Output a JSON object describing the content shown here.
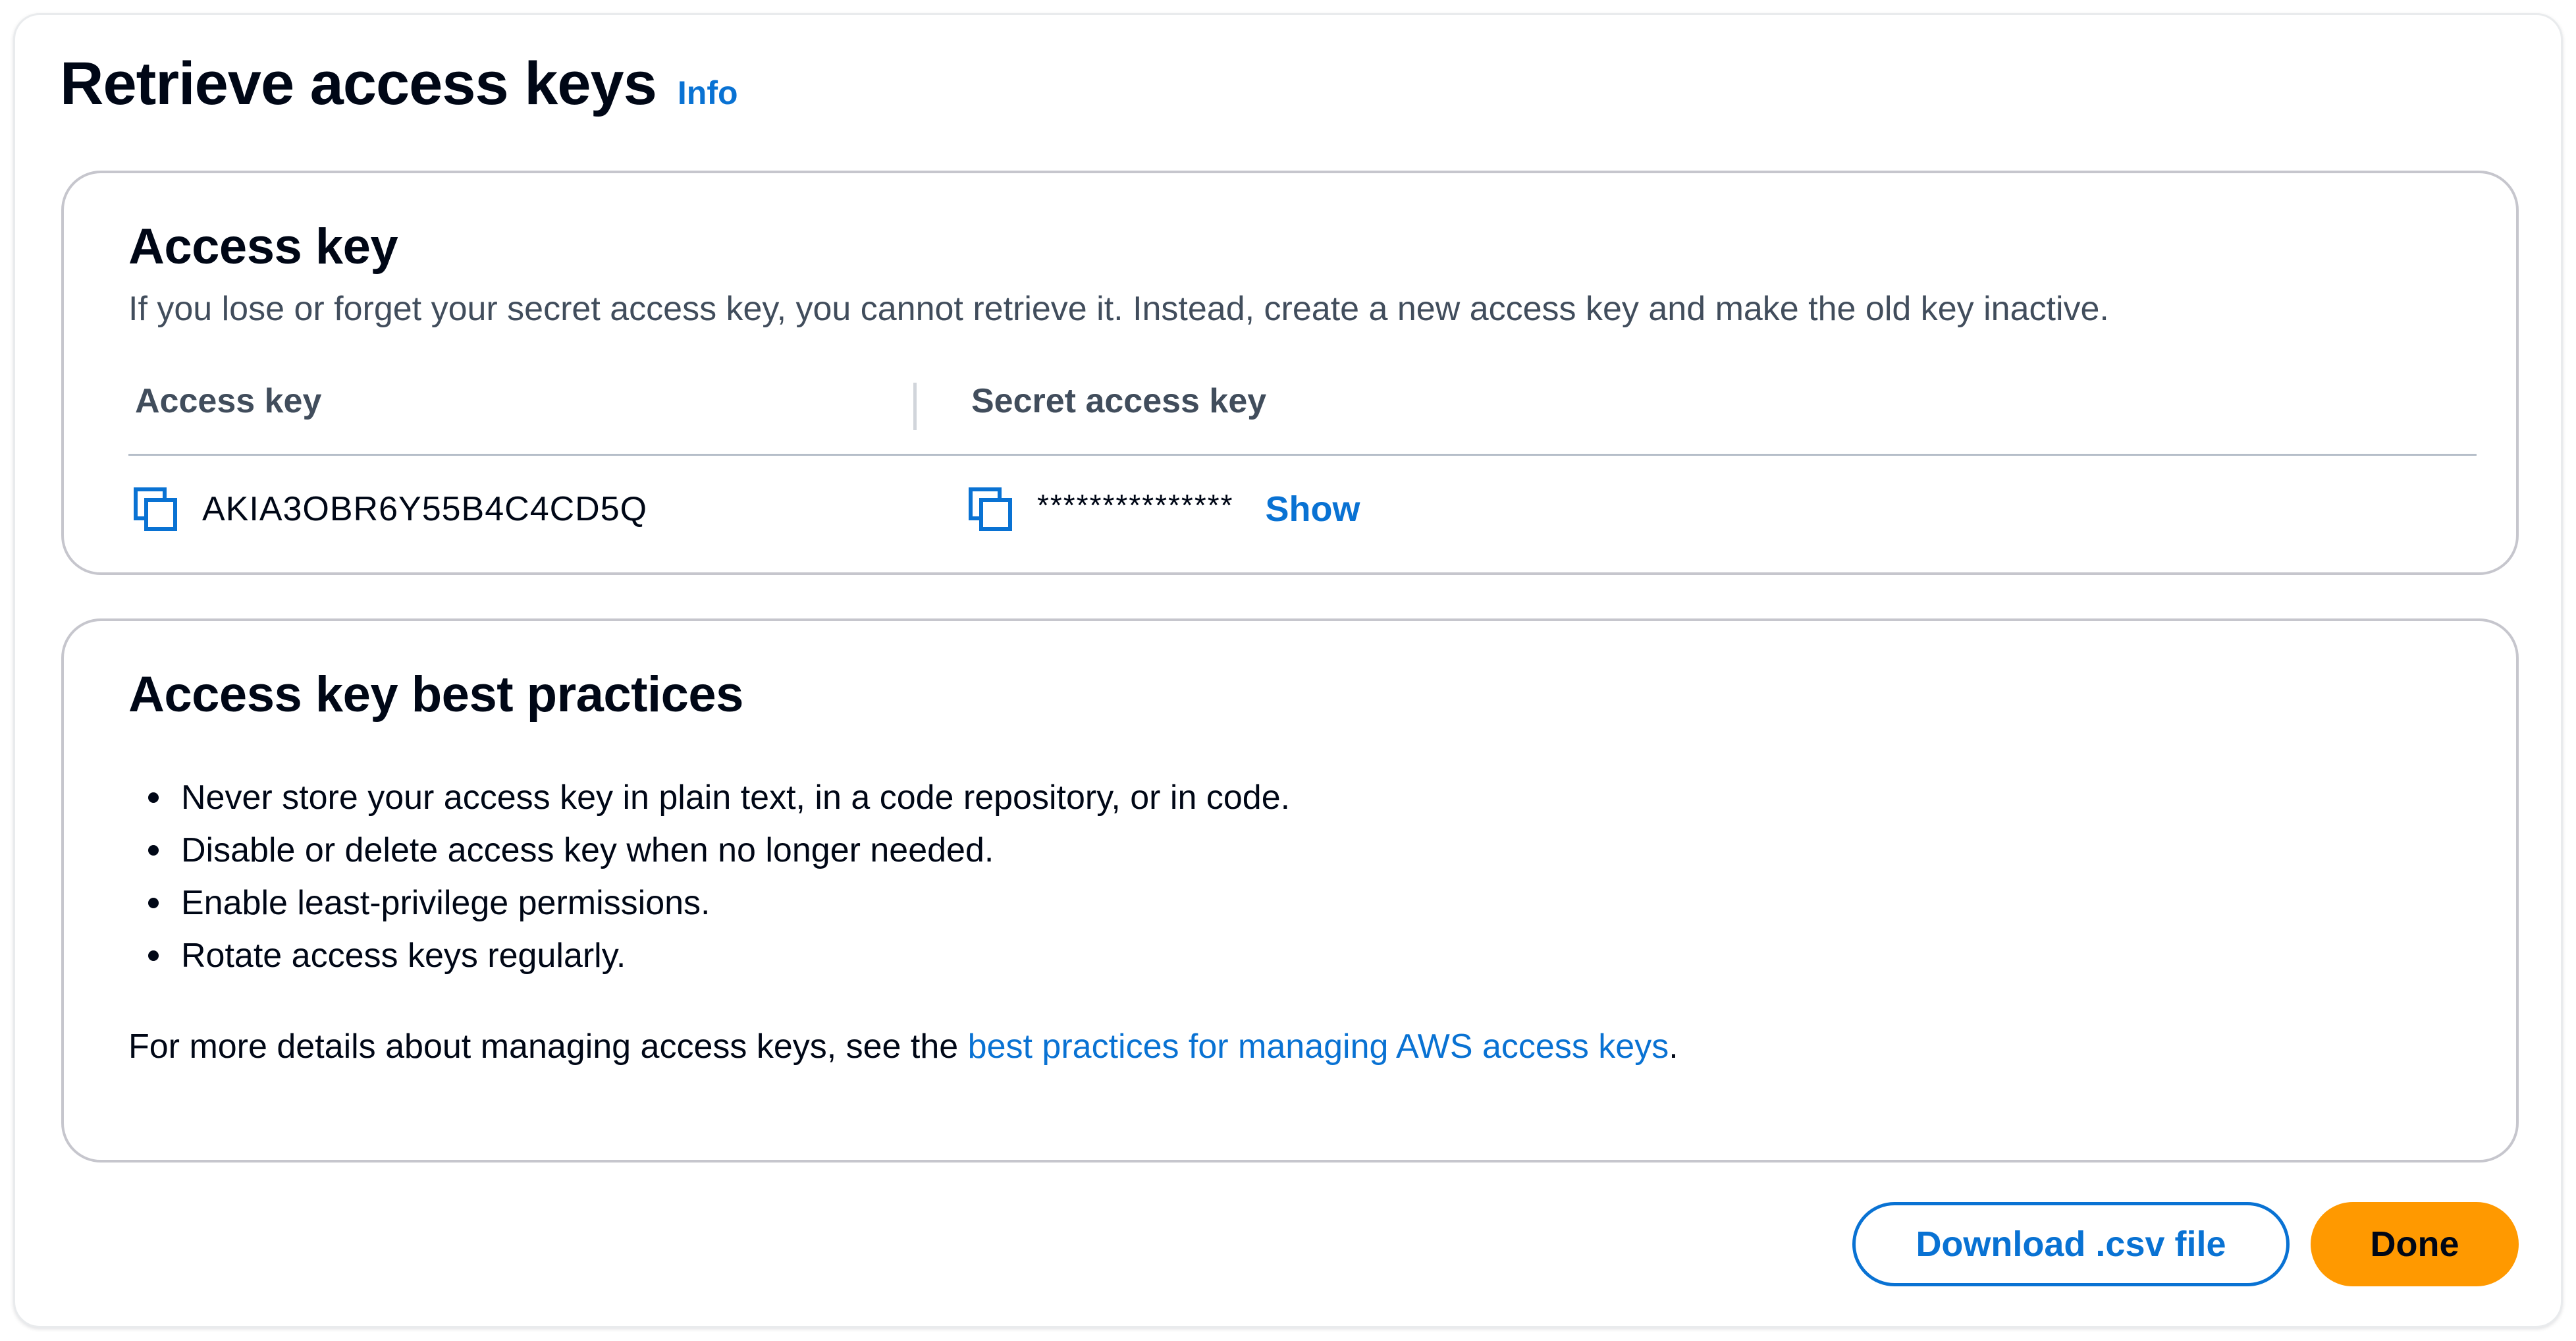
{
  "header": {
    "title": "Retrieve access keys",
    "info_link": "Info"
  },
  "access_key_section": {
    "title": "Access key",
    "description": "If you lose or forget your secret access key, you cannot retrieve it. Instead, create a new access key and make the old key inactive.",
    "columns": {
      "access_key": "Access key",
      "secret_access_key": "Secret access key"
    },
    "access_key_value": "AKIA3OBR6Y55B4C4CD5Q",
    "secret_masked": "***************",
    "show_label": "Show",
    "copy_icon": "copy-icon"
  },
  "best_practices": {
    "title": "Access key best practices",
    "items": [
      "Never store your access key in plain text, in a code repository, or in code.",
      "Disable or delete access key when no longer needed.",
      "Enable least-privilege permissions.",
      "Rotate access keys regularly."
    ],
    "more_details_prefix": "For more details about managing access keys, see the ",
    "more_details_link": "best practices for managing AWS access keys",
    "more_details_suffix": "."
  },
  "actions": {
    "download_label": "Download .csv file",
    "done_label": "Done"
  },
  "colors": {
    "link": "#0972d3",
    "primary_button": "#ff9900",
    "text": "#000716",
    "secondary_text": "#414d5c",
    "border": "#c6c6cd"
  }
}
